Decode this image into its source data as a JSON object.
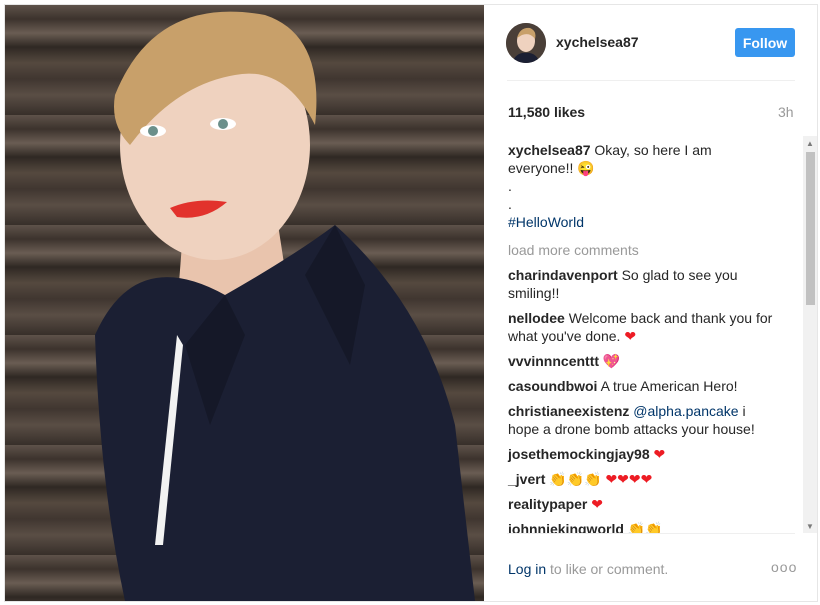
{
  "post": {
    "username": "xychelsea87",
    "follow_label": "Follow",
    "likes": "11,580 likes",
    "time": "3h"
  },
  "caption": {
    "user": "xychelsea87",
    "text": "Okay, so here I am everyone!!",
    "emoji": "😜",
    "dot1": ".",
    "dot2": ".",
    "hashtag": "#HelloWorld"
  },
  "load_more": "load more comments",
  "comments": [
    {
      "user": "charindavenport",
      "text": "So glad to see you smiling!!"
    },
    {
      "user": "nellodee",
      "text": "Welcome back and thank you for what you've done.",
      "emoji": "❤"
    },
    {
      "user": "vvvinnncenttt",
      "text": "",
      "emoji": "💖"
    },
    {
      "user": "casoundbwoi",
      "text": "A true American Hero!"
    },
    {
      "user": "christianeexistenz",
      "mention": "@alpha.pancake",
      "text": "i hope a drone bomb attacks your house!"
    },
    {
      "user": "josethemockingjay98",
      "text": "",
      "emoji": "❤"
    },
    {
      "user": "_jvert",
      "text": "",
      "claps": "👏👏👏",
      "hearts": "❤❤❤❤"
    },
    {
      "user": "realitypaper",
      "text": "",
      "emoji": "❤"
    },
    {
      "user": "johnniekingworld",
      "text": "",
      "claps": "👏👏"
    }
  ],
  "footer": {
    "login": "Log in",
    "rest": " to like or comment.",
    "more": "ooo"
  },
  "colors": {
    "accent": "#3897f0",
    "link": "#003569",
    "muted": "#999999"
  },
  "icons": {
    "scroll_up": "triangle-up",
    "scroll_down": "triangle-down",
    "more": "ellipsis"
  }
}
